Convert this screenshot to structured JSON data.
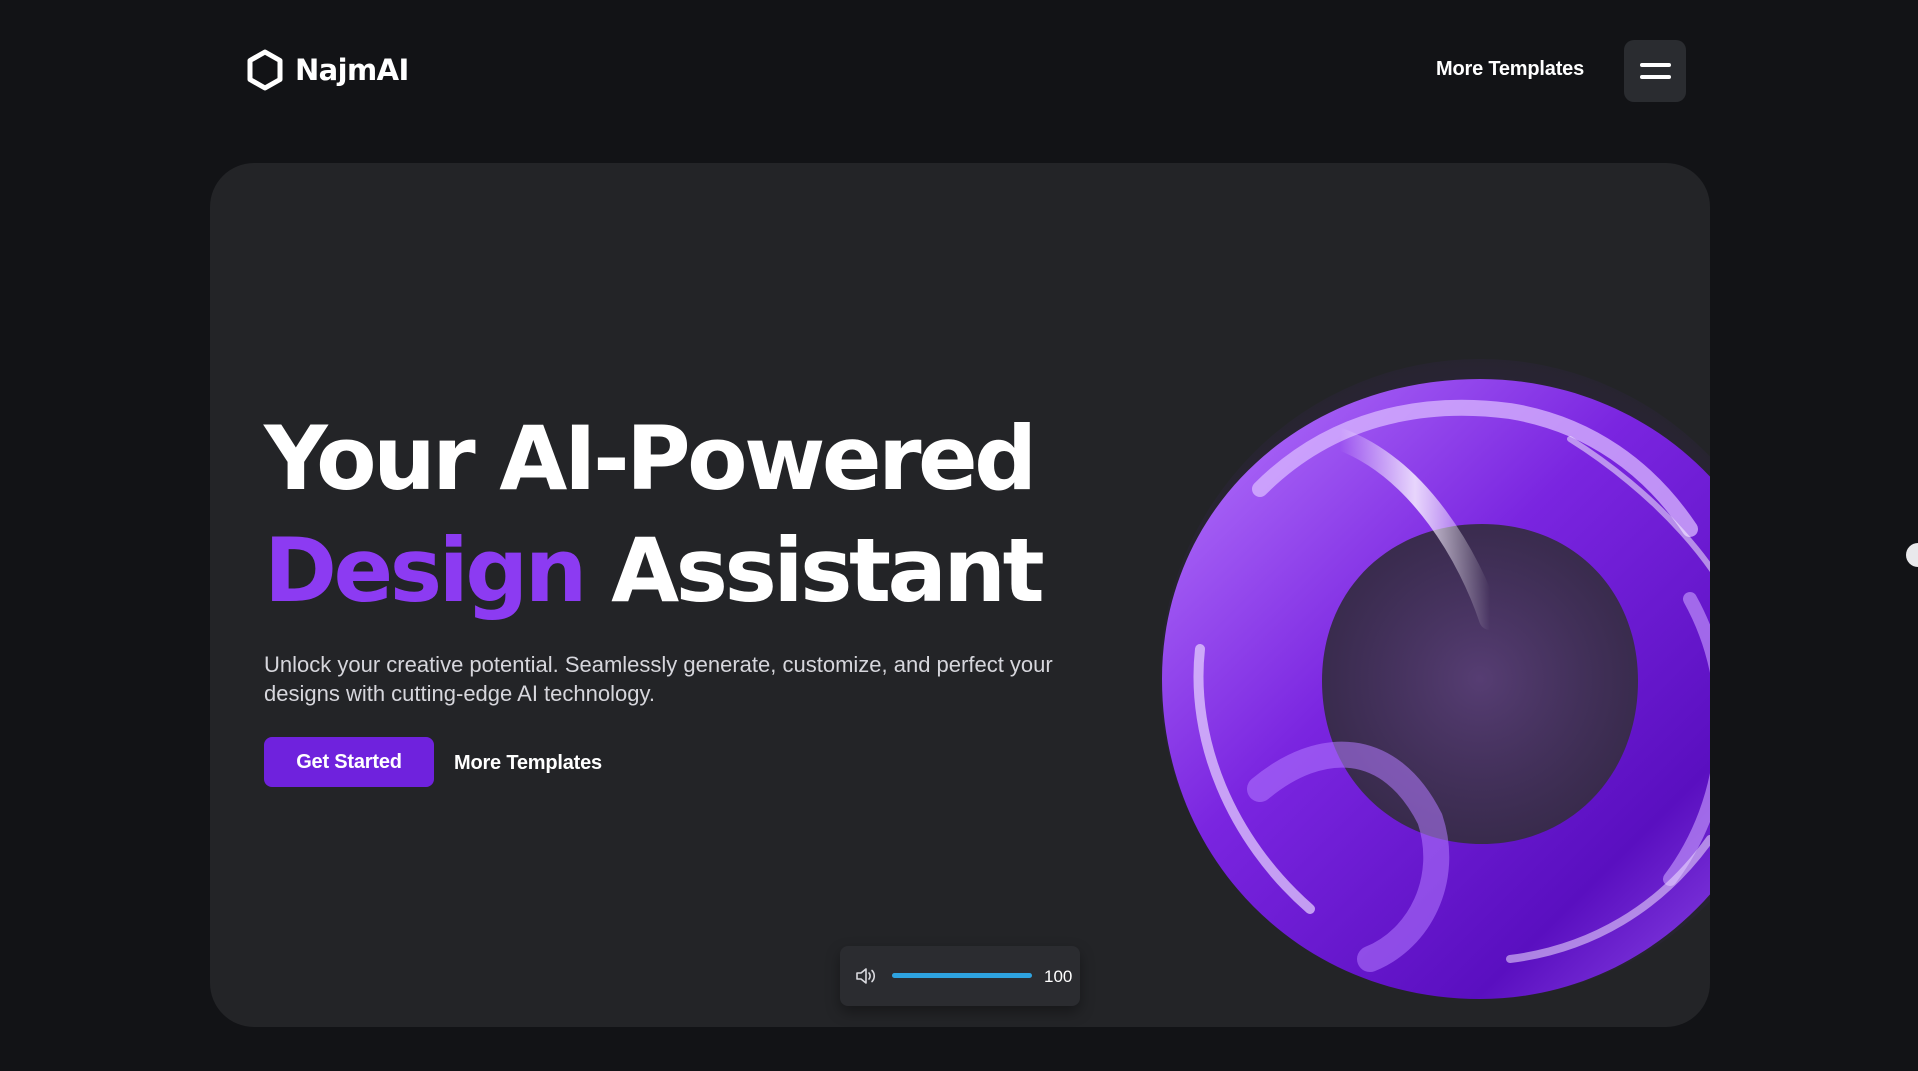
{
  "header": {
    "brand_name": "NajmAI",
    "logo_icon": "hexagon-icon",
    "nav_link": "More Templates",
    "menu_icon": "hamburger-menu-icon"
  },
  "hero": {
    "title_line1": "Your AI-Powered",
    "title_accent": "Design",
    "title_rest": "Assistant",
    "subtitle": "Unlock your creative potential. Seamlessly generate, customize, and perfect your designs with cutting-edge AI technology.",
    "cta_label": "Get Started",
    "secondary_link": "More Templates",
    "art": "purple-glass-torus-image"
  },
  "volume": {
    "icon": "speaker-icon",
    "value": "100",
    "level_percent": 100
  },
  "colors": {
    "page_background": "#121316",
    "card_background": "#232427",
    "accent": "#8c3bf2",
    "cta": "#6f22dd",
    "slider": "#2ea3e0"
  }
}
